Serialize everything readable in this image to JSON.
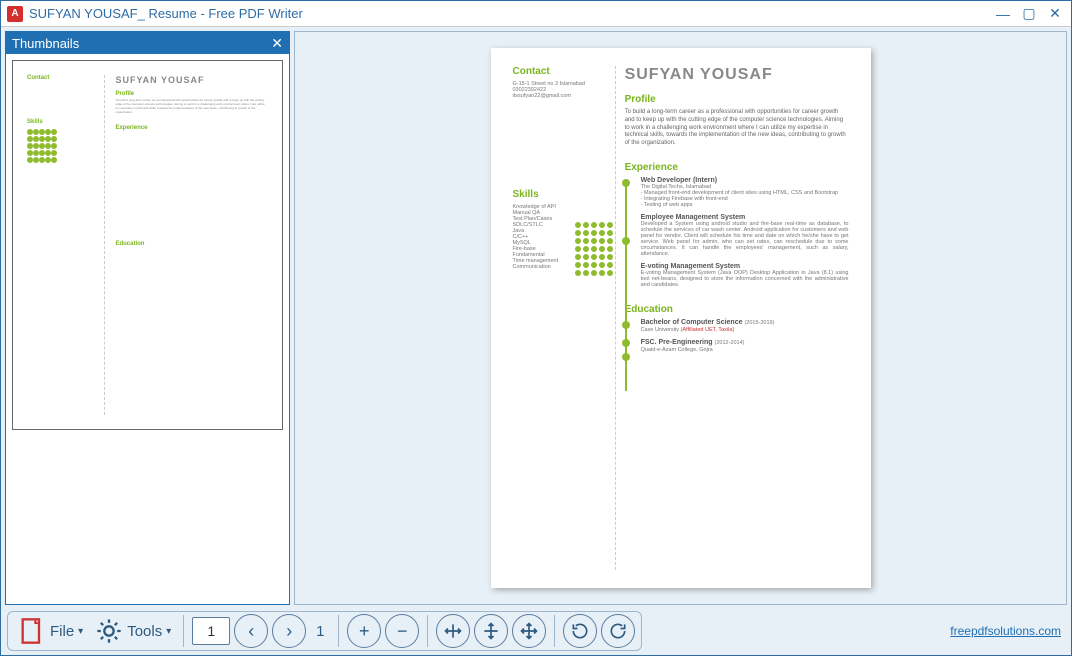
{
  "window": {
    "title": "SUFYAN YOUSAF_ Resume - Free PDF Writer",
    "app_icon_letter": "A"
  },
  "thumbnails": {
    "title": "Thumbnails"
  },
  "toolbar": {
    "file_label": "File",
    "tools_label": "Tools",
    "current_page": "1",
    "total_pages": "1"
  },
  "footer": {
    "link_text": "freepdfsolutions.com"
  },
  "resume": {
    "name": "SUFYAN YOUSAF",
    "contact_head": "Contact",
    "contact_lines": [
      "G-15-1 Street no 3 Islamabad",
      "03022392422",
      "itssufyan22@gmail.com"
    ],
    "profile_head": "Profile",
    "profile_text": "To build a long-term career as a professional with opportunities for career growth and to keep up with the cutting edge of the computer science technologies. Aiming to work in a challenging work environment where I can utilize my expertise in technical skills, towards the implementation of the new ideas, contributing to growth of the organization.",
    "skills_head": "Skills",
    "skills": [
      "Knowledge of API",
      "Manual QA",
      "Test Plan/Cases",
      "SDLC/STLC",
      "Java",
      "C/C++",
      "MySQL",
      "Fire-base",
      "Fundamental",
      "Time management",
      "Communication"
    ],
    "experience_head": "Experience",
    "exp1_title": "Web Developer (Intern)",
    "exp1_sub": "The Digital Techs, Islamabad",
    "exp1_bullets": [
      "- Managed front-end development of client sites using HTML, CSS and Bootstrap",
      "- Integrating Firebase with front-end",
      "- Testing of web apps"
    ],
    "exp2_title": "Employee Management System",
    "exp2_text": "Developed a System using android studio and fire-base real-time as database, to schedule the services of car wash center. Android application for customers and web panel for vendor. Client will schedule his time and date on which he/she have to get service. Web panel for admin, who can set rates, can reschedule due to some circumstances. It can handle the employees' management, such as salary, attendance.",
    "exp3_title": "E-voting Management System",
    "exp3_text": "E-voting Management System (Java OOP) Desktop Application in Java (8.1) using tool net-beans, designed to store the information concerned with the administrative and candidates.",
    "education_head": "Education",
    "edu1_title": "Bachelor of Computer Science",
    "edu1_years": "(2015-2019)",
    "edu1_sub": "Case University ",
    "edu1_aff": "(Affiliated UET, Taxila)",
    "edu2_title": "FSC. Pre-Engineering",
    "edu2_years": "(2012-2014)",
    "edu2_sub": "Quaid-e-Azam College, Gojra"
  }
}
